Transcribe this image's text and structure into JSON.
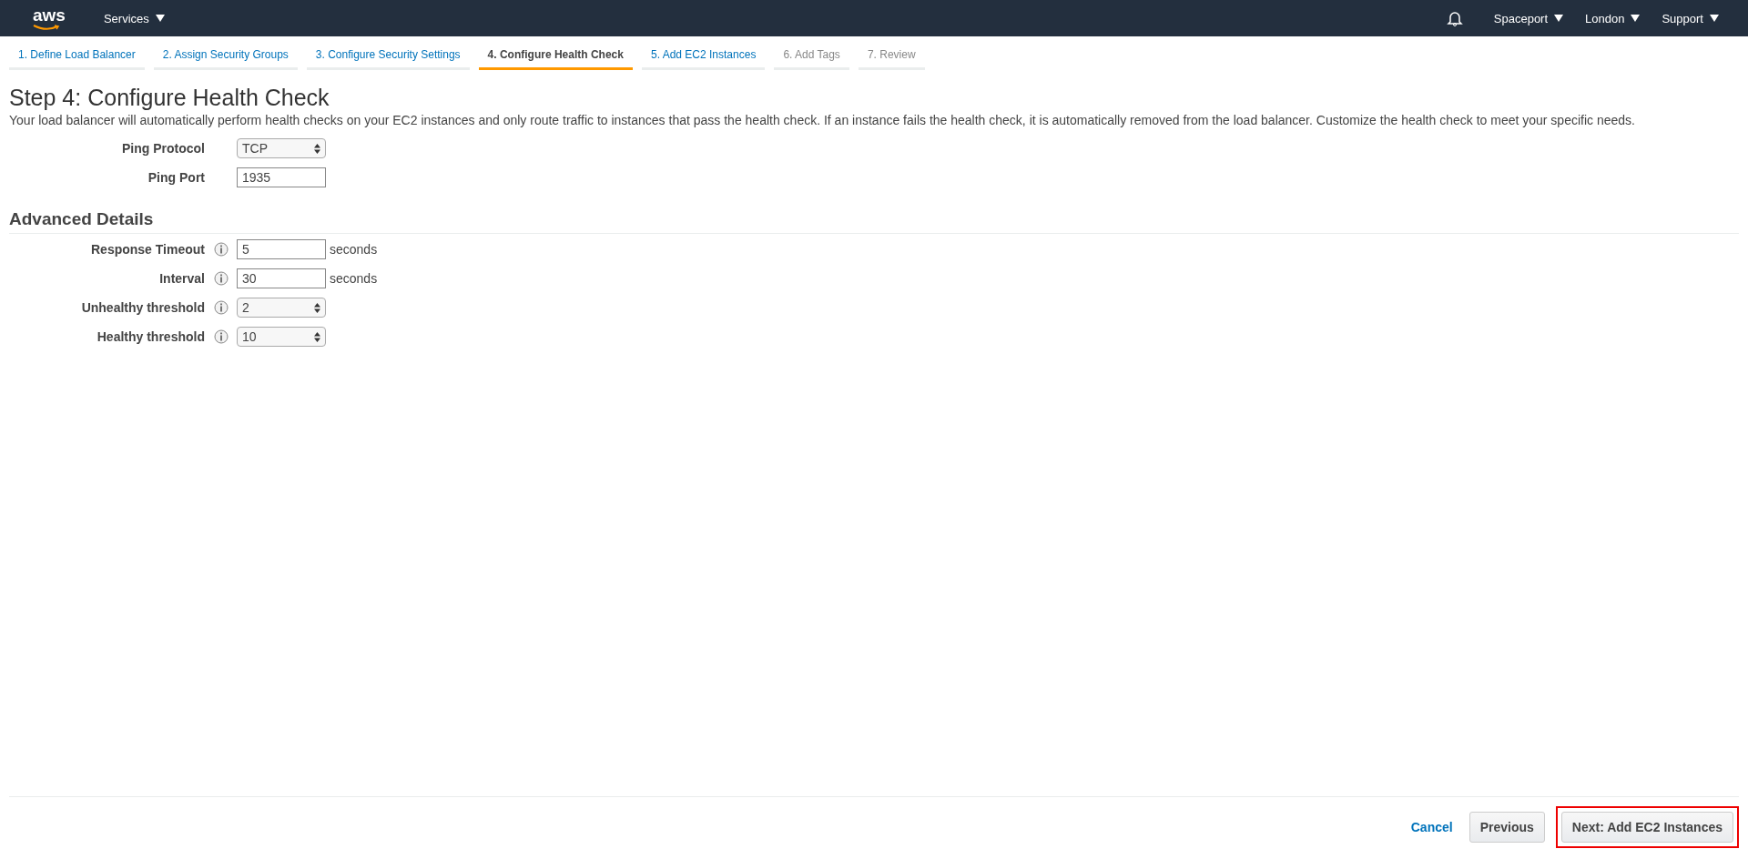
{
  "top_nav": {
    "logo": "aws",
    "services": "Services",
    "right_items": [
      "Spaceport",
      "London",
      "Support"
    ]
  },
  "wizard_steps": [
    {
      "label": "1. Define Load Balancer",
      "selected": false,
      "disabled": false
    },
    {
      "label": "2. Assign Security Groups",
      "selected": false,
      "disabled": false
    },
    {
      "label": "3. Configure Security Settings",
      "selected": false,
      "disabled": false
    },
    {
      "label": "4. Configure Health Check",
      "selected": true,
      "disabled": false
    },
    {
      "label": "5. Add EC2 Instances",
      "selected": false,
      "disabled": false
    },
    {
      "label": "6. Add Tags",
      "selected": false,
      "disabled": true
    },
    {
      "label": "7. Review",
      "selected": false,
      "disabled": true
    }
  ],
  "page_title": "Step 4: Configure Health Check",
  "description": "Your load balancer will automatically perform health checks on your EC2 instances and only route traffic to instances that pass the health check. If an instance fails the health check, it is automatically removed from the load balancer. Customize the health check to meet your specific needs.",
  "basic_fields": [
    {
      "label": "Ping Protocol",
      "kind": "select",
      "value": "TCP"
    },
    {
      "label": "Ping Port",
      "kind": "input",
      "value": "1935"
    }
  ],
  "advanced_section": {
    "title": "Advanced Details",
    "fields": [
      {
        "label": "Response Timeout",
        "kind": "input",
        "value": "5",
        "unit": "seconds"
      },
      {
        "label": "Interval",
        "kind": "input",
        "value": "30",
        "unit": "seconds"
      },
      {
        "label": "Unhealthy threshold",
        "kind": "select",
        "value": "2"
      },
      {
        "label": "Healthy threshold",
        "kind": "select",
        "value": "10"
      }
    ]
  },
  "footer": {
    "cancel": "Cancel",
    "previous": "Previous",
    "next": {
      "label": "Next: Add EC2 Instances",
      "highlighted": true
    }
  }
}
